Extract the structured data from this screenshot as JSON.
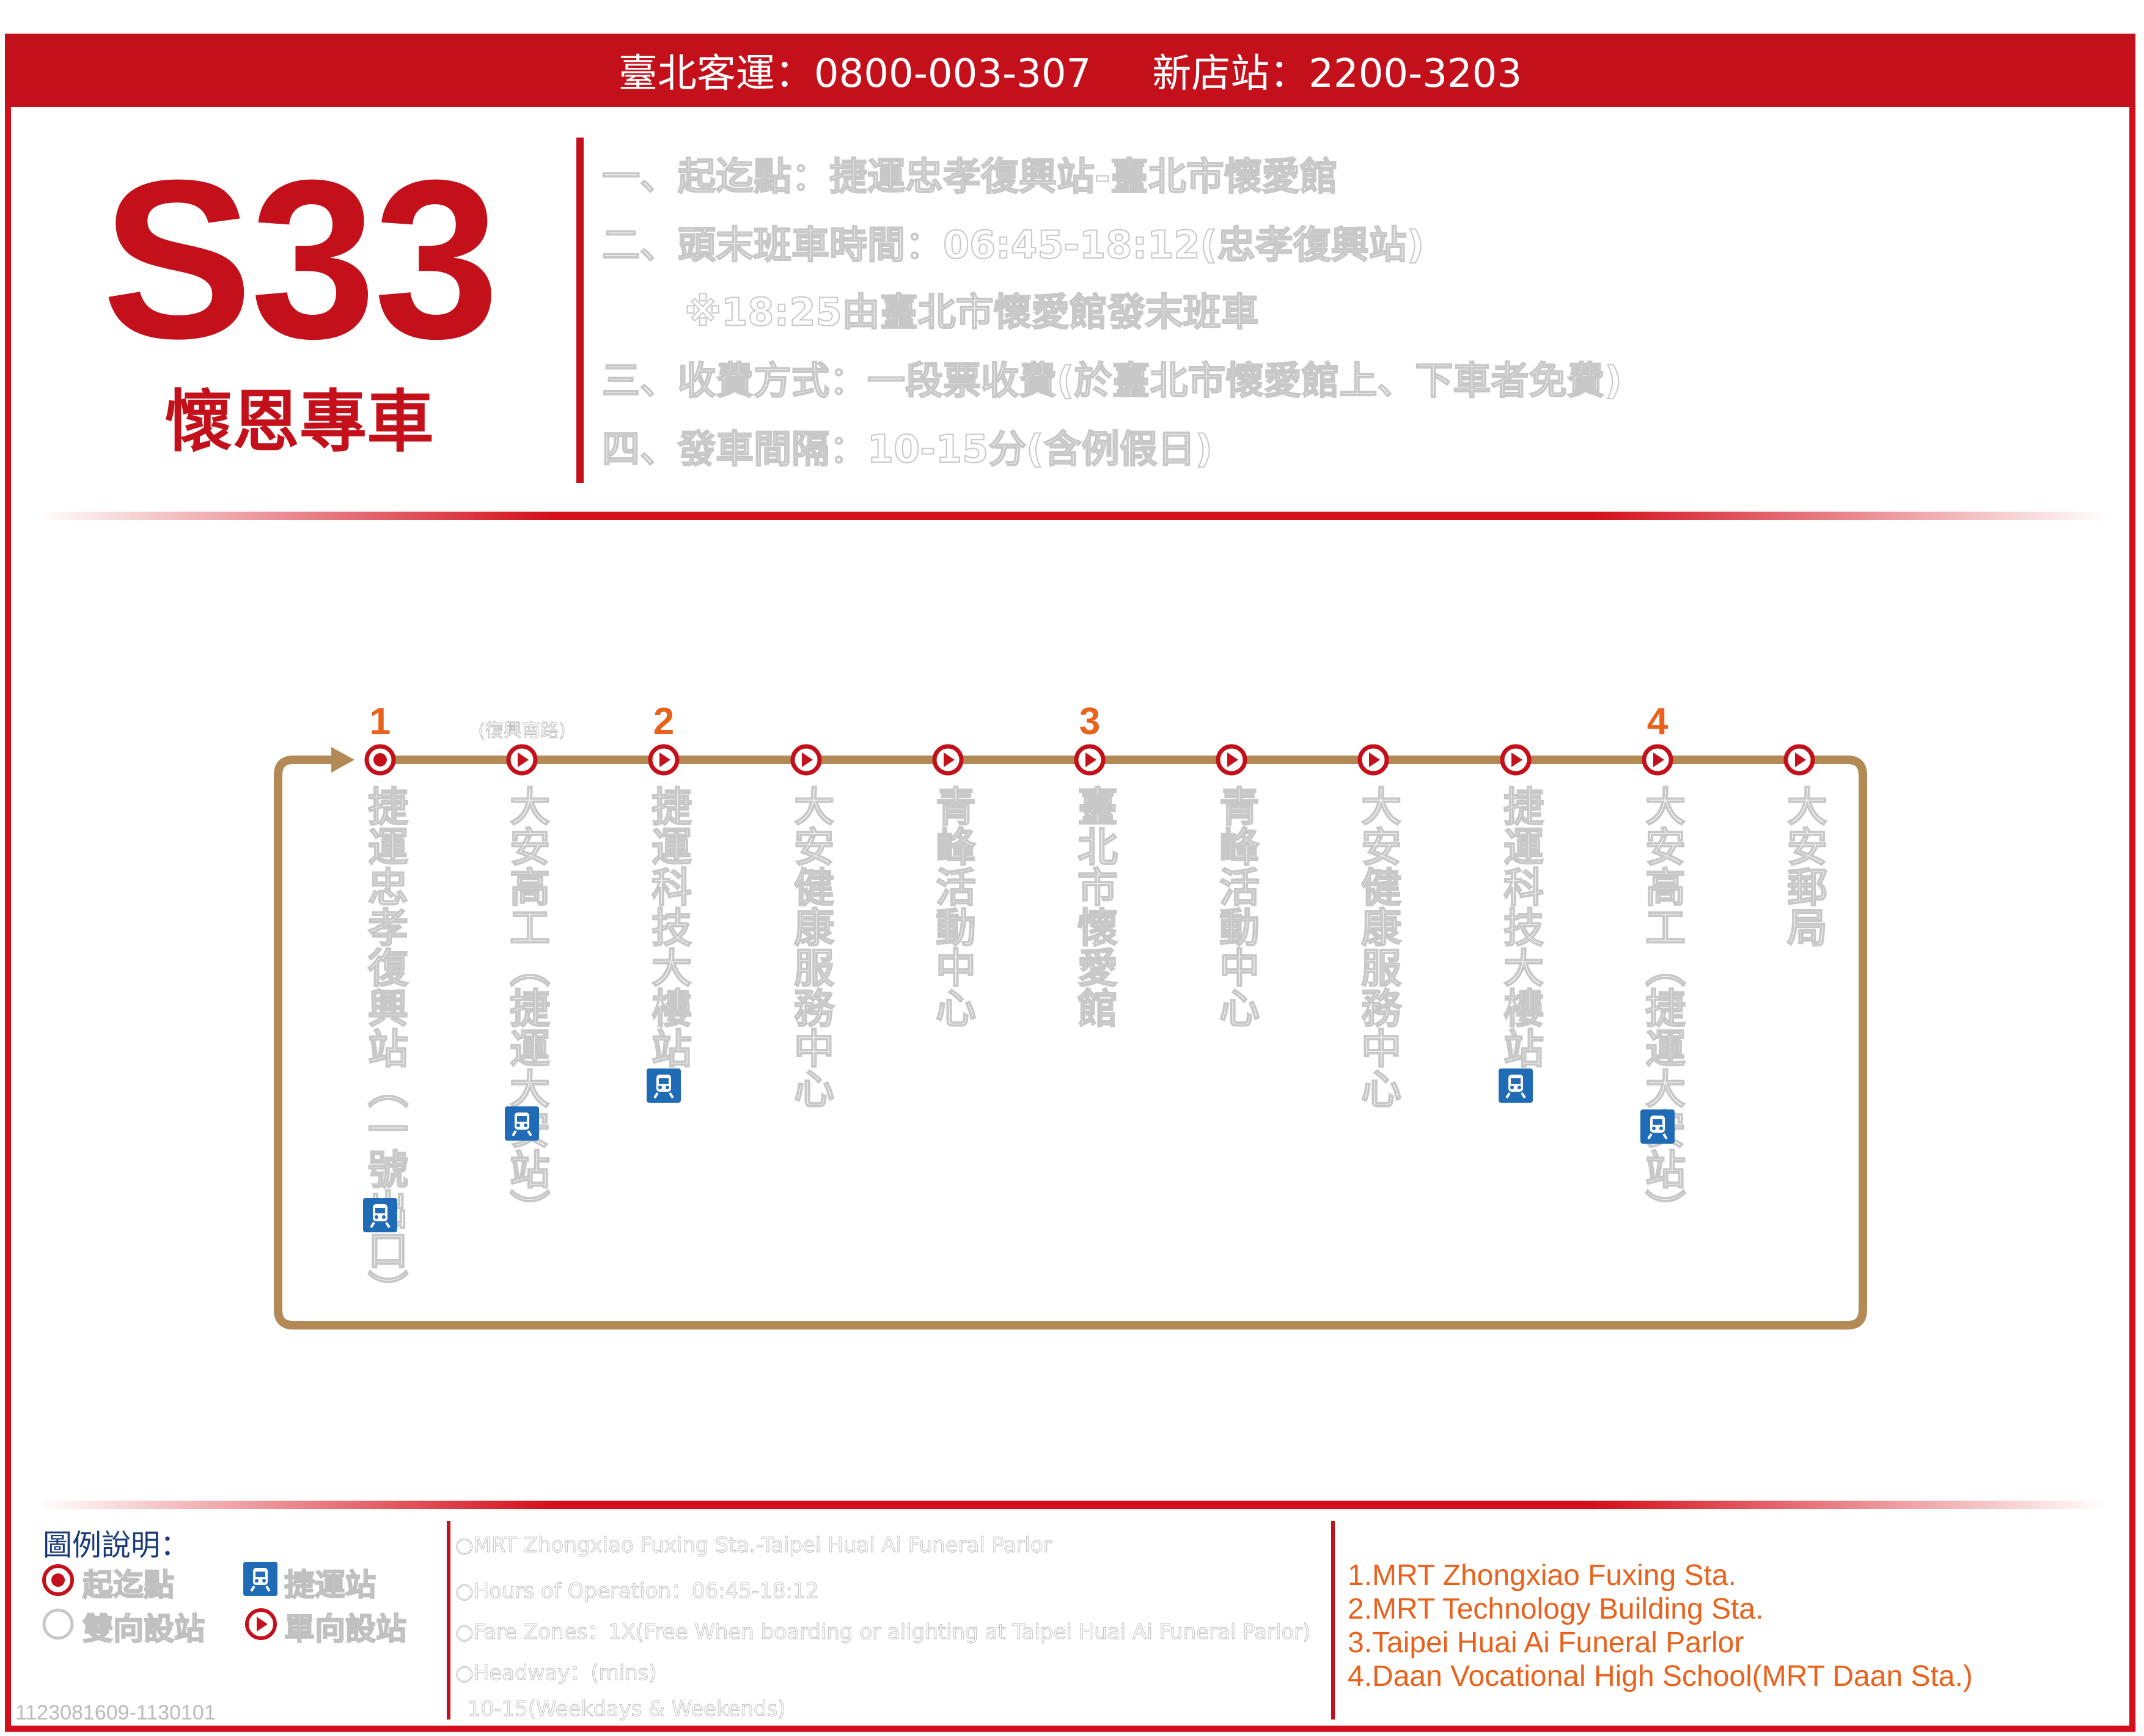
{
  "header": {
    "company_phone": "臺北客運：0800-003-307",
    "station_phone": "新店站：2200-3203"
  },
  "route": {
    "number": "S33",
    "name": "懷恩專車"
  },
  "info": {
    "lines": [
      "一、起迄點：捷運忠孝復興站-臺北市懷愛館",
      "二、頭末班車時間：06:45-18:12(忠孝復興站)",
      "※18:25由臺北市懷愛館發末班車",
      "三、收費方式：一段票收費(於臺北市懷愛館上、下車者免費)",
      "四、發車間隔：10-15分(含例假日)"
    ]
  },
  "colors": {
    "brand_red": "#c4101a",
    "route_line": "#b38a55",
    "stop_number": "#e8621c",
    "mrt_blue": "#1f6bb5"
  },
  "stops": [
    {
      "number": "1",
      "name": "捷運忠孝復興站（一號出口）",
      "type": "terminal",
      "mrt": true
    },
    {
      "note": "(復興南路)",
      "name": "大安高工（捷運大安站）",
      "type": "one-way",
      "mrt": true
    },
    {
      "number": "2",
      "name": "捷運科技大樓站",
      "type": "one-way",
      "mrt": true
    },
    {
      "name": "大安健康服務中心",
      "type": "one-way",
      "mrt": false
    },
    {
      "name": "青峰活動中心",
      "type": "one-way",
      "mrt": false
    },
    {
      "number": "3",
      "name": "臺北市懷愛館",
      "type": "one-way",
      "mrt": false
    },
    {
      "name": "青峰活動中心",
      "type": "one-way",
      "mrt": false
    },
    {
      "name": "大安健康服務中心",
      "type": "one-way",
      "mrt": false
    },
    {
      "name": "捷運科技大樓站",
      "type": "one-way",
      "mrt": true
    },
    {
      "number": "4",
      "name": "大安高工（捷運大安站）",
      "type": "one-way",
      "mrt": true
    },
    {
      "name": "大安郵局",
      "type": "one-way",
      "mrt": false
    }
  ],
  "legend": {
    "title": "圖例說明：",
    "terminal": "起迄點",
    "mrt": "捷運站",
    "two_way": "雙向設站",
    "one_way": "單向設站",
    "mrt_icon": "train-icon"
  },
  "english": {
    "lines": [
      "○MRT Zhongxiao Fuxing Sta.-Taipei Huai Ai Funeral Parlor",
      "○Hours of Operation：06:45-18:12",
      "○Fare Zones：1X(Free When boarding or alighting at Taipei Huai Ai Funeral Parlor)",
      "○Headway：(mins)",
      "10-15(Weekdays & Weekends)"
    ]
  },
  "points": {
    "lines": [
      "1.MRT Zhongxiao Fuxing Sta.",
      "2.MRT Technology Building Sta.",
      "3.Taipei Huai Ai Funeral Parlor",
      "4.Daan Vocational High School(MRT Daan Sta.)"
    ]
  },
  "code": "1123081609-1130101"
}
